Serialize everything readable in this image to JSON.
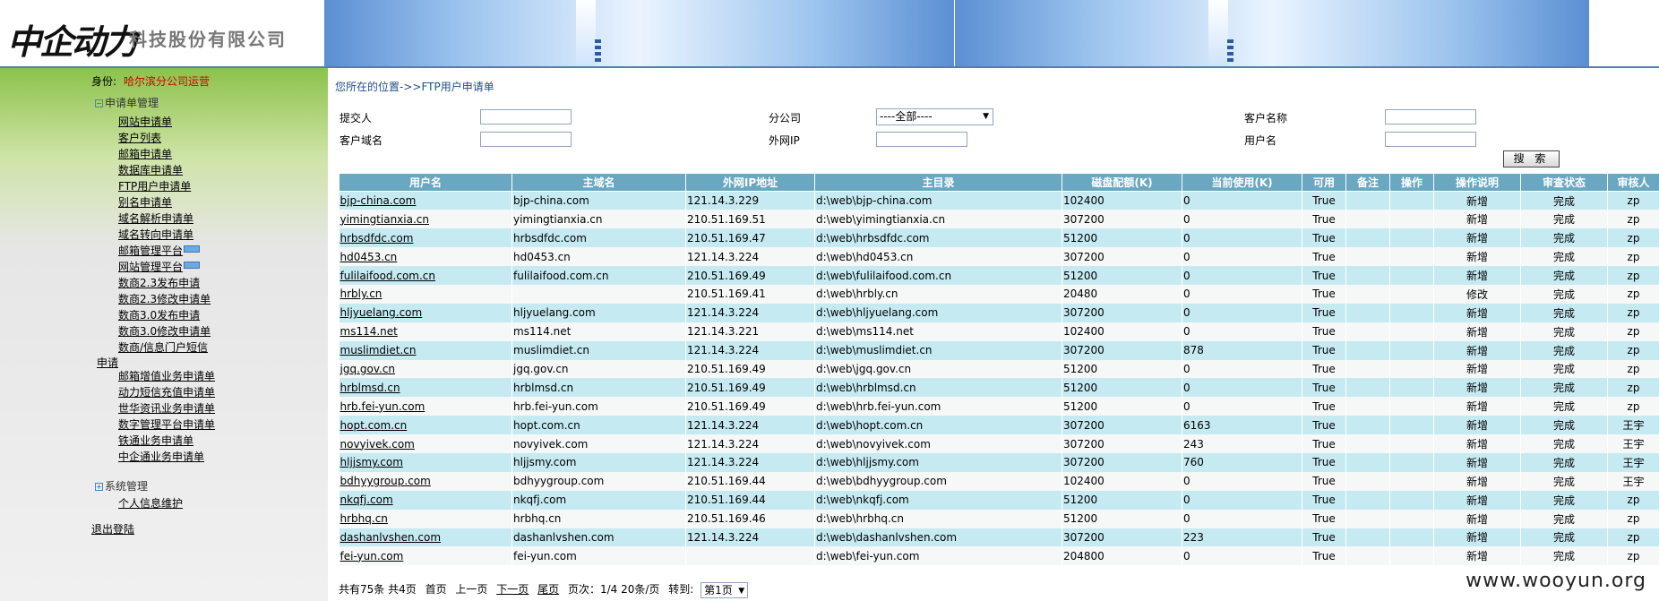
{
  "header": {
    "logo_script": "中企动力",
    "logo_company": "科技股份有限公司"
  },
  "sidebar": {
    "identity_label": "身份:",
    "identity_value": "哈尔滨分公司运营",
    "group_apply": "申请单管理",
    "items": [
      "网站申请单",
      "客户列表",
      "邮箱申请单",
      "数据库申请单",
      "FTP用户申请单",
      "别名申请单",
      "域名解析申请单",
      "域名转向申请单",
      "邮箱管理平台",
      "网站管理平台",
      "数商2.3发布申请",
      "数商2.3修改申请单",
      "数商3.0发布申请",
      "数商3.0修改申请单",
      "数商/信息门户短信",
      "申请",
      "邮箱增值业务申请单",
      "动力短信充值申请单",
      "世华资讯业务申请单",
      "数字管理平台申请单",
      "铁通业务申请单",
      "中企通业务申请单"
    ],
    "group_system": "系统管理",
    "system_items": [
      "个人信息维护"
    ],
    "logout": "退出登陆"
  },
  "main": {
    "breadcrumb": "您所在的位置->>FTP用户申请单",
    "filters": {
      "submitter_label": "提交人",
      "branch_label": "分公司",
      "branch_value": "----全部----",
      "customer_name_label": "客户名称",
      "customer_domain_label": "客户域名",
      "public_ip_label": "外网IP",
      "username_label": "用户名",
      "search_button": "搜 索"
    },
    "table": {
      "headers": [
        "用户名",
        "主域名",
        "外网IP地址",
        "主目录",
        "磁盘配额(K)",
        "当前使用(K)",
        "可用",
        "备注",
        "操作",
        "操作说明",
        "审查状态",
        "审核人"
      ],
      "rows": [
        [
          "bjp-china.com",
          "bjp-china.com",
          "121.14.3.229",
          "d:\\web\\bjp-china.com",
          "102400",
          "0",
          "True",
          "",
          "",
          "新增",
          "完成",
          "zp"
        ],
        [
          "yimingtianxia.cn",
          "yimingtianxia.cn",
          "210.51.169.51",
          "d:\\web\\yimingtianxia.cn",
          "307200",
          "0",
          "True",
          "",
          "",
          "新增",
          "完成",
          "zp"
        ],
        [
          "hrbsdfdc.com",
          "hrbsdfdc.com",
          "210.51.169.47",
          "d:\\web\\hrbsdfdc.com",
          "51200",
          "0",
          "True",
          "",
          "",
          "新增",
          "完成",
          "zp"
        ],
        [
          "hd0453.cn",
          "hd0453.cn",
          "121.14.3.224",
          "d:\\web\\hd0453.cn",
          "307200",
          "0",
          "True",
          "",
          "",
          "新增",
          "完成",
          "zp"
        ],
        [
          "fulilaifood.com.cn",
          "fulilaifood.com.cn",
          "210.51.169.49",
          "d:\\web\\fulilaifood.com.cn",
          "51200",
          "0",
          "True",
          "",
          "",
          "新增",
          "完成",
          "zp"
        ],
        [
          "hrbly.cn",
          "",
          "210.51.169.41",
          "d:\\web\\hrbly.cn",
          "20480",
          "0",
          "True",
          "",
          "",
          "修改",
          "完成",
          "zp"
        ],
        [
          "hljyuelang.com",
          "hljyuelang.com",
          "121.14.3.224",
          "d:\\web\\hljyuelang.com",
          "307200",
          "0",
          "True",
          "",
          "",
          "新增",
          "完成",
          "zp"
        ],
        [
          "ms114.net",
          "ms114.net",
          "121.14.3.221",
          "d:\\web\\ms114.net",
          "102400",
          "0",
          "True",
          "",
          "",
          "新增",
          "完成",
          "zp"
        ],
        [
          "muslimdiet.cn",
          "muslimdiet.cn",
          "121.14.3.224",
          "d:\\web\\muslimdiet.cn",
          "307200",
          "878",
          "True",
          "",
          "",
          "新增",
          "完成",
          "zp"
        ],
        [
          "jgq.gov.cn",
          "jgq.gov.cn",
          "210.51.169.49",
          "d:\\web\\jgq.gov.cn",
          "51200",
          "0",
          "True",
          "",
          "",
          "新增",
          "完成",
          "zp"
        ],
        [
          "hrblmsd.cn",
          "hrblmsd.cn",
          "210.51.169.49",
          "d:\\web\\hrblmsd.cn",
          "51200",
          "0",
          "True",
          "",
          "",
          "新增",
          "完成",
          "zp"
        ],
        [
          "hrb.fei-yun.com",
          "hrb.fei-yun.com",
          "210.51.169.49",
          "d:\\web\\hrb.fei-yun.com",
          "51200",
          "0",
          "True",
          "",
          "",
          "新增",
          "完成",
          "zp"
        ],
        [
          "hopt.com.cn",
          "hopt.com.cn",
          "121.14.3.224",
          "d:\\web\\hopt.com.cn",
          "307200",
          "6163",
          "True",
          "",
          "",
          "新增",
          "完成",
          "王宇"
        ],
        [
          "novyivek.com",
          "novyivek.com",
          "121.14.3.224",
          "d:\\web\\novyivek.com",
          "307200",
          "243",
          "True",
          "",
          "",
          "新增",
          "完成",
          "王宇"
        ],
        [
          "hljjsmy.com",
          "hljjsmy.com",
          "121.14.3.224",
          "d:\\web\\hljjsmy.com",
          "307200",
          "760",
          "True",
          "",
          "",
          "新增",
          "完成",
          "王宇"
        ],
        [
          "bdhyygroup.com",
          "bdhyygroup.com",
          "210.51.169.44",
          "d:\\web\\bdhyygroup.com",
          "102400",
          "0",
          "True",
          "",
          "",
          "新增",
          "完成",
          "王宇"
        ],
        [
          "nkqfj.com",
          "nkqfj.com",
          "210.51.169.44",
          "d:\\web\\nkqfj.com",
          "51200",
          "0",
          "True",
          "",
          "",
          "新增",
          "完成",
          "zp"
        ],
        [
          "hrbhq.cn",
          "hrbhq.cn",
          "210.51.169.46",
          "d:\\web\\hrbhq.cn",
          "51200",
          "0",
          "True",
          "",
          "",
          "新增",
          "完成",
          "zp"
        ],
        [
          "dashanlvshen.com",
          "dashanlvshen.com",
          "121.14.3.224",
          "d:\\web\\dashanlvshen.com",
          "307200",
          "223",
          "True",
          "",
          "",
          "新增",
          "完成",
          "zp"
        ],
        [
          "fei-yun.com",
          "fei-yun.com",
          "",
          "d:\\web\\fei-yun.com",
          "204800",
          "0",
          "True",
          "",
          "",
          "新增",
          "完成",
          "zp"
        ]
      ]
    },
    "pager": {
      "total": "共有75条",
      "pages": "共4页",
      "first": "首页",
      "prev": "上一页",
      "next": "下一页",
      "last": "尾页",
      "page_info": "页次：1/4",
      "per_page": "20条/页",
      "goto_label": "转到:",
      "goto_value": "第1页"
    }
  },
  "watermark": "www.wooyun.org"
}
